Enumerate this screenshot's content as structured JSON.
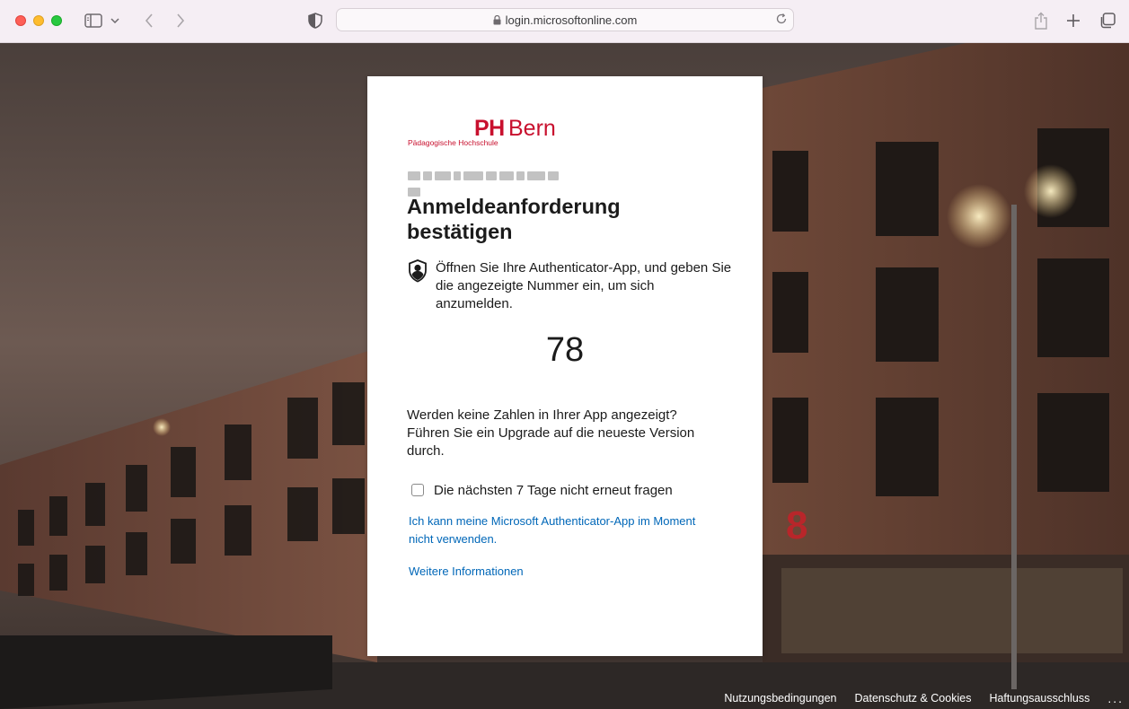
{
  "browser": {
    "url": "login.microsoftonline.com"
  },
  "logo": {
    "ph": "PH",
    "bern": "Bern",
    "subtitle": "Pädagogische Hochschule"
  },
  "card": {
    "title": "Anmeldeanforderung bestätigen",
    "instruction": "Öffnen Sie Ihre Authenticator-App, und geben Sie die angezeigte Nummer ein, um sich anzumelden.",
    "number": "78",
    "upgrade_text": "Werden keine Zahlen in Ihrer App angezeigt? Führen Sie ein Upgrade auf die neueste Version durch.",
    "checkbox_label": "Die nächsten 7 Tage nicht erneut fragen",
    "link_cannot_use": "Ich kann meine Microsoft Authenticator-App im Moment nicht verwenden.",
    "link_more_info": "Weitere Informationen"
  },
  "footer": {
    "terms": "Nutzungsbedingungen",
    "privacy": "Datenschutz & Cookies",
    "disclaimer": "Haftungsausschluss",
    "more": "..."
  },
  "colors": {
    "brand_red": "#c8102e",
    "link_blue": "#0067b8",
    "chrome_bg": "#f5eef4"
  }
}
